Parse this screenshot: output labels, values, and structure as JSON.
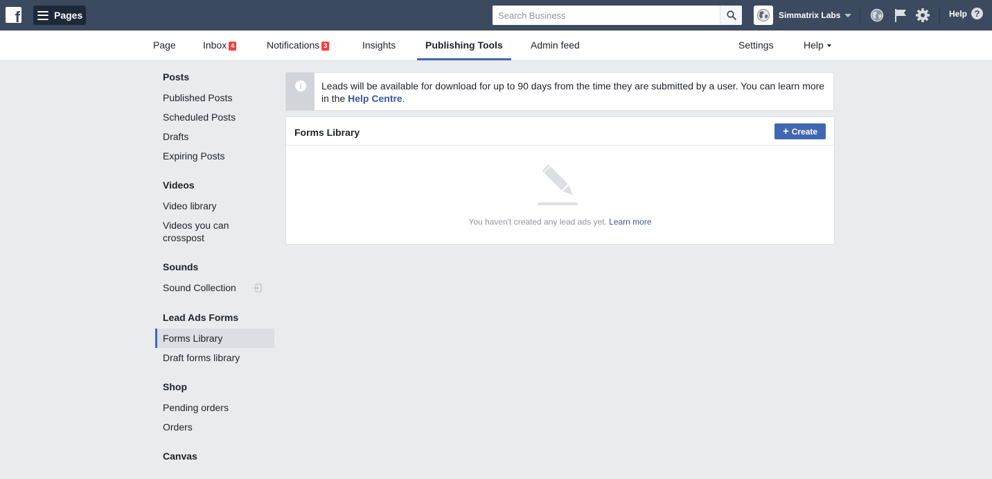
{
  "topbar": {
    "logo_icon": "facebook-logo-icon",
    "pages_label": "Pages",
    "search_placeholder": "Search Business",
    "account_name": "Simmatrix Labs",
    "help_label": "Help"
  },
  "tabs": {
    "page": "Page",
    "inbox": "Inbox",
    "inbox_badge": "4",
    "notifications": "Notifications",
    "notifications_badge": "3",
    "insights": "Insights",
    "publishing_tools": "Publishing Tools",
    "admin_feed": "Admin feed",
    "settings": "Settings",
    "help": "Help"
  },
  "sidebar": {
    "posts_header": "Posts",
    "published_posts": "Published Posts",
    "scheduled_posts": "Scheduled Posts",
    "drafts": "Drafts",
    "expiring_posts": "Expiring Posts",
    "videos_header": "Videos",
    "video_library": "Video library",
    "videos_crosspost": "Videos you can crosspost",
    "sounds_header": "Sounds",
    "sound_collection": "Sound Collection",
    "lead_ads_header": "Lead Ads Forms",
    "forms_library": "Forms Library",
    "draft_forms_library": "Draft forms library",
    "shop_header": "Shop",
    "pending_orders": "Pending orders",
    "orders": "Orders",
    "canvas_header": "Canvas"
  },
  "notice": {
    "text": "Leads will be available for download for up to 90 days from the time they are submitted by a user. You can learn more in the ",
    "link": "Help Centre",
    "end": "."
  },
  "card": {
    "title": "Forms Library",
    "create_label": "Create",
    "empty_text": "You haven't created any lead ads yet. ",
    "learn_more": "Learn more"
  },
  "colors": {
    "topbar": "#3b4a5e",
    "accent": "#4267b2",
    "badge": "#fa3e3e",
    "link": "#365899"
  }
}
